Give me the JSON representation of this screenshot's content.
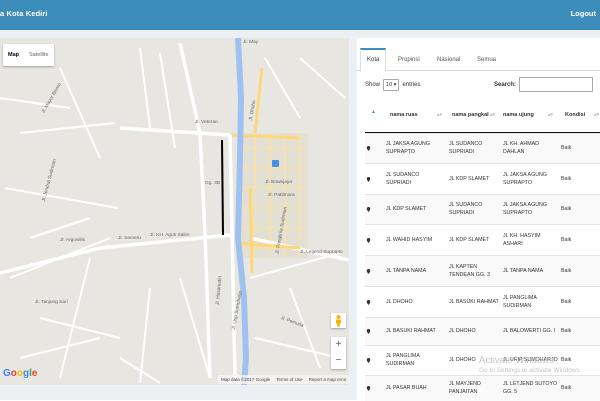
{
  "header": {
    "brand": "a Kota Kediri",
    "logout_label": "Logout"
  },
  "map": {
    "type_map": "Map",
    "type_satellite": "Satellite",
    "zoom_in": "+",
    "zoom_out": "−",
    "google_logo": [
      "G",
      "o",
      "o",
      "g",
      "l",
      "e"
    ],
    "attribution": {
      "data": "Map data ©2017 Google",
      "terms": "Terms of Use",
      "report": "Report a map error"
    },
    "road_labels": [
      "Jl. May",
      "Jl. Mayor Bismo",
      "Jl. Dhoho",
      "Jl. Letjend Suprapto",
      "Jl. Urip Sumoharjo",
      "Jl. KH. Agus Salim",
      "Jl. Semeru",
      "Jl. Veteran",
      "Jl. Argowilis",
      "Jl. Jendral Sudirman",
      "Jl. Panglima Sudirman",
      "Jl. Hasanudin",
      "Jl. Pattimura",
      "Jl. Tanjung Sari",
      "Jl. Pemuda",
      "Gg. 3B",
      "Jl. Brawijaya"
    ]
  },
  "panel": {
    "tabs": [
      "Kota",
      "Propinsi",
      "Nasional",
      "Semua"
    ],
    "show_label": "Show",
    "entries_value": "10",
    "entries_label": "entries",
    "search_label": "Search:",
    "columns": [
      "nama ruas",
      "nama pangkal",
      "nama ujung",
      "Kondisi"
    ],
    "rows": [
      [
        "JL JAKSA AGUNG SUPRAPTO",
        "JL SUDANCO SUPRIADI",
        "JL KH. AHMAD DAHLAN",
        "Baik"
      ],
      [
        "JL SUDANCO SUPRIADI",
        "JL KDP SLAMET",
        "JL JAKSA AGUNG SUPRAPTO",
        "Baik"
      ],
      [
        "JL KDP SLAMET",
        "JL SUDANCO SUPRIADI",
        "JL JAKSA AGUNG SUPRAPTO",
        "Baik"
      ],
      [
        "JL WAHID HASYIM",
        "JL KDP SLAMET",
        "JL KH. HASYIM ASHARI",
        "Baik"
      ],
      [
        "JL TANPA NAMA",
        "JL KAPTEN TENDEAN GG. 3",
        "JL TANPA NAMA",
        "Baik"
      ],
      [
        "JL DHOHO",
        "JL BASUKI RAHMAT",
        "JL PANGLIMA SUDIRMAN",
        "Baik"
      ],
      [
        "JL BASUKI RAHMAT",
        "JL DHOHO",
        "JL BALOWERTI GG. I",
        "Baik"
      ],
      [
        "JL PANGLIMA SUDIRMAN",
        "JL DHOHO",
        "JL URIP SUMOHARJO",
        "Baik"
      ],
      [
        "JL PASAR BUAH",
        "JL MAYJEND PANJAITAN",
        "JL LETJEND SUTOYO GG. 5",
        "Baik"
      ]
    ]
  },
  "watermark": {
    "title": "Activate Windows",
    "subtitle": "Go to Settings to activate Windows."
  },
  "icons": {
    "row_marker": "map-marker-icon",
    "pegman": "pegman-icon",
    "sort": "sort-arrows-icon"
  },
  "colors": {
    "header": "#3c8dbc",
    "road_selected": "#000000",
    "river": "#aac8ff",
    "main_road": "#ffe7a1"
  }
}
